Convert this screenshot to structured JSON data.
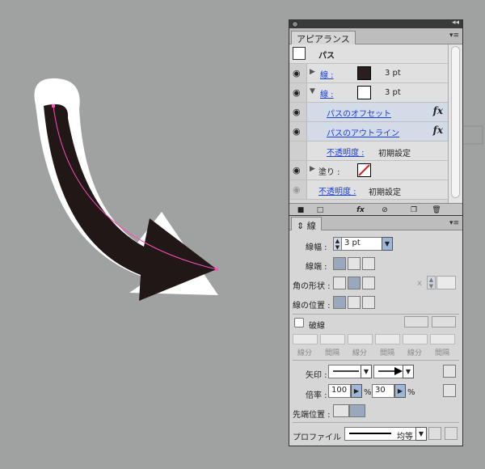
{
  "appearance": {
    "tab": "アピアランス",
    "rows": [
      {
        "kind": "header",
        "label": "パス"
      },
      {
        "kind": "stroke",
        "label": "線 :",
        "swatch": "#2a1f1e",
        "value": "3 pt"
      },
      {
        "kind": "stroke",
        "label": "線 :",
        "swatch": "#ffffff",
        "value": "3 pt"
      },
      {
        "kind": "effect",
        "label": "パスのオフセット",
        "fx": "fx"
      },
      {
        "kind": "effect",
        "label": "パスのアウトライン",
        "fx": "fx"
      },
      {
        "kind": "opacity",
        "label": "不透明度 :",
        "value": "初期設定"
      },
      {
        "kind": "fill",
        "label": "塗り :"
      },
      {
        "kind": "opacity",
        "label": "不透明度 :",
        "value": "初期設定"
      }
    ],
    "footer_icons": [
      "new-stroke-icon",
      "new-fill-icon",
      "fx-menu-icon",
      "clear-icon",
      "duplicate-icon",
      "delete-icon"
    ]
  },
  "stroke": {
    "tab": "線",
    "weight_label": "線幅 :",
    "weight_value": "3 pt",
    "cap_label": "線端 :",
    "corner_label": "角の形状 :",
    "limit_label": "x",
    "align_label": "線の位置 :",
    "dashed_label": "破線",
    "dash_labels": [
      "線分",
      "間隔",
      "線分",
      "間隔",
      "線分",
      "間隔"
    ],
    "arrow_label": "矢印 :",
    "scale_label": "倍率 :",
    "scale_start": "100",
    "scale_end": "30",
    "percent": "%",
    "tip_label": "先端位置 :",
    "profile_label": "プロファイル :",
    "profile_value": "均等"
  },
  "colors": {
    "arrow": "#221717",
    "outline": "#ffffff",
    "path": "#ff4fc0",
    "callout": "#d8261f"
  }
}
